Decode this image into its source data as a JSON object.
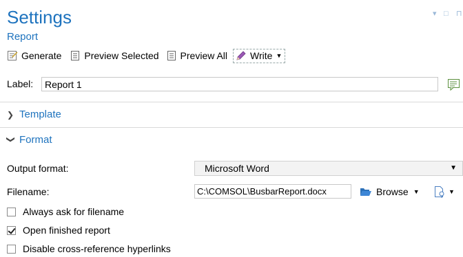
{
  "header": {
    "title": "Settings",
    "subtitle": "Report",
    "window_controls": [
      "▾",
      "□",
      "⊓"
    ]
  },
  "toolbar": {
    "generate_label": "Generate",
    "preview_selected_label": "Preview Selected",
    "preview_all_label": "Preview All",
    "write_label": "Write"
  },
  "label_row": {
    "label": "Label:",
    "value": "Report 1"
  },
  "sections": {
    "template": "Template",
    "format": "Format"
  },
  "format": {
    "output_format_label": "Output format:",
    "output_format_value": "Microsoft Word",
    "filename_label": "Filename:",
    "filename_value": "C:\\COMSOL\\BusbarReport.docx",
    "browse_label": "Browse"
  },
  "checkboxes": [
    {
      "label": "Always ask for filename",
      "checked": false
    },
    {
      "label": "Open finished report",
      "checked": true
    },
    {
      "label": "Disable cross-reference hyperlinks",
      "checked": false
    }
  ],
  "colors": {
    "accent": "#1e73be",
    "divider": "#d9d9d9"
  }
}
